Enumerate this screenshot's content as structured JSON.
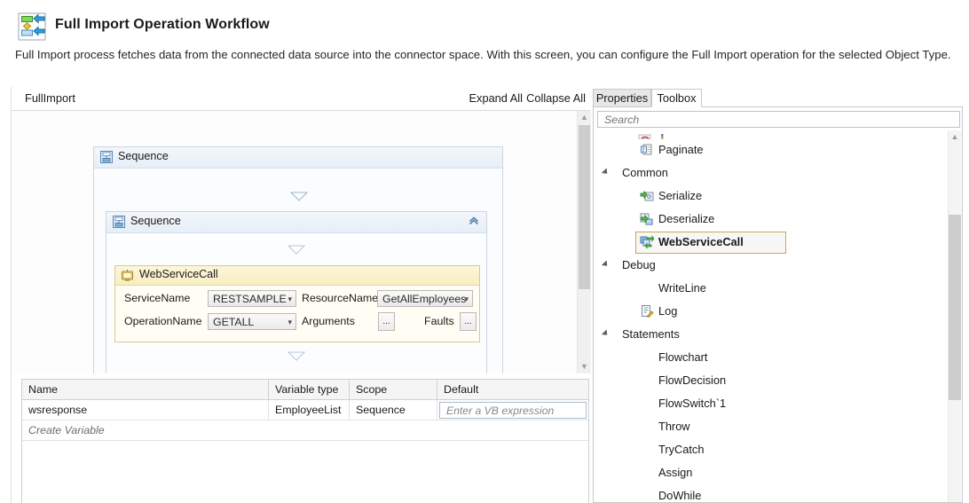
{
  "header": {
    "icon": "import-workflow-icon",
    "title": "Full Import Operation Workflow",
    "description": "Full Import process fetches data from the connected data source into the connector space. With this screen, you can configure the Full Import operation for the selected Object Type."
  },
  "designer": {
    "breadcrumb": "FullImport",
    "expand_all": "Expand All",
    "collapse_all": "Collapse All",
    "activities": {
      "outer_sequence": {
        "label": "Sequence",
        "icon": "sequence-icon"
      },
      "inner_sequence": {
        "label": "Sequence",
        "icon": "sequence-icon",
        "collapse_icon": "double-chevron-up-icon"
      },
      "web_service_call": {
        "label": "WebServiceCall",
        "icon": "webservicecall-icon",
        "fields": [
          {
            "label": "ServiceName",
            "value": "RESTSAMPLE",
            "type": "combobox"
          },
          {
            "label": "ResourceName",
            "value": "GetAllEmployees",
            "type": "combobox"
          },
          {
            "label": "OperationName",
            "value": "GETALL",
            "type": "combobox"
          },
          {
            "label": "Arguments",
            "value": "...",
            "type": "ellipsis-button"
          },
          {
            "label": "Faults",
            "value": "...",
            "type": "ellipsis-button"
          }
        ]
      }
    }
  },
  "variables": {
    "columns": [
      "Name",
      "Variable type",
      "Scope",
      "Default"
    ],
    "rows": [
      {
        "name": "wsresponse",
        "type": "EmployeeList",
        "scope": "Sequence",
        "default": "",
        "default_placeholder": "Enter a VB expression"
      }
    ],
    "create_row_label": "Create Variable"
  },
  "toolbox": {
    "tabs": [
      {
        "label": "Properties",
        "active": false
      },
      {
        "label": "Toolbox",
        "active": true
      }
    ],
    "search_placeholder": "Search",
    "tree": [
      {
        "kind": "leaf",
        "label": "Paginate",
        "icon": "paginate-icon",
        "selected": false,
        "indent": true
      },
      {
        "kind": "group",
        "label": "Common",
        "expanded": true
      },
      {
        "kind": "leaf",
        "label": "Serialize",
        "icon": "serialize-icon",
        "selected": false,
        "indent": true
      },
      {
        "kind": "leaf",
        "label": "Deserialize",
        "icon": "deserialize-icon",
        "selected": false,
        "indent": true
      },
      {
        "kind": "leaf",
        "label": "WebServiceCall",
        "icon": "webservicecall-icon",
        "selected": true,
        "indent": true
      },
      {
        "kind": "group",
        "label": "Debug",
        "expanded": true
      },
      {
        "kind": "leaf",
        "label": "WriteLine",
        "icon": "",
        "selected": false,
        "indent": true
      },
      {
        "kind": "leaf",
        "label": "Log",
        "icon": "log-icon",
        "selected": false,
        "indent": true
      },
      {
        "kind": "group",
        "label": "Statements",
        "expanded": true
      },
      {
        "kind": "leaf",
        "label": "Flowchart",
        "icon": "",
        "selected": false,
        "indent": true
      },
      {
        "kind": "leaf",
        "label": "FlowDecision",
        "icon": "",
        "selected": false,
        "indent": true
      },
      {
        "kind": "leaf",
        "label": "FlowSwitch`1",
        "icon": "",
        "selected": false,
        "indent": true
      },
      {
        "kind": "leaf",
        "label": "Throw",
        "icon": "",
        "selected": false,
        "indent": true
      },
      {
        "kind": "leaf",
        "label": "TryCatch",
        "icon": "",
        "selected": false,
        "indent": true
      },
      {
        "kind": "leaf",
        "label": "Assign",
        "icon": "",
        "selected": false,
        "indent": true
      },
      {
        "kind": "leaf",
        "label": "DoWhile",
        "icon": "",
        "selected": false,
        "indent": true
      }
    ]
  },
  "colors": {
    "selection_border": "#d2a34a",
    "activity_yellow": "#f7eec2",
    "sequence_blue": "#e6eef7",
    "scrollbar_thumb": "#cdcdcd"
  }
}
